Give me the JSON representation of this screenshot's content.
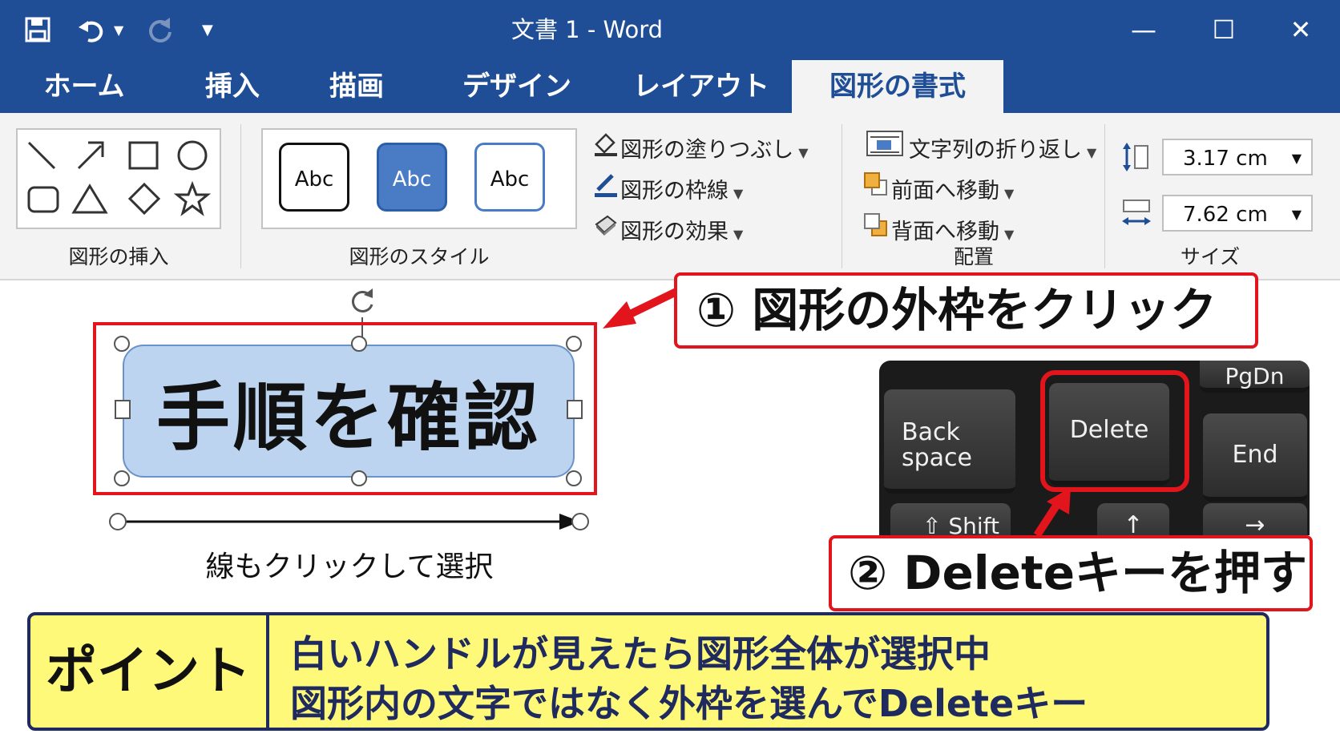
{
  "window": {
    "title": "文書 1 - Word",
    "minimize": "—",
    "maximize": "☐",
    "close": "✕"
  },
  "quick_access": {
    "save_icon": "save-icon",
    "undo_icon": "undo-icon",
    "redo_icon": "redo-icon",
    "customize_icon": "customize-icon"
  },
  "tabs": [
    {
      "label": "ホーム"
    },
    {
      "label": "挿入"
    },
    {
      "label": "描画"
    },
    {
      "label": "デザイン"
    },
    {
      "label": "レイアウト"
    },
    {
      "label": "図形の書式",
      "active": true
    }
  ],
  "ribbon": {
    "insert_shapes": {
      "label": "図形の挿入",
      "shapes": [
        "line-icon",
        "arrow-icon",
        "rectangle-icon",
        "oval-icon",
        "rounded-rectangle-icon",
        "triangle-icon",
        "diamond-icon",
        "star-icon"
      ]
    },
    "shape_styles": {
      "label": "図形のスタイル",
      "samples": [
        "Abc",
        "Abc",
        "Abc"
      ],
      "fill": "図形の塗りつぶし",
      "outline": "図形の枠線",
      "effects": "図形の効果"
    },
    "arrange": {
      "label": "配置",
      "wrap": "文字列の折り返し",
      "bring_forward": "前面へ移動",
      "send_backward": "背面へ移動"
    },
    "size": {
      "label": "サイズ",
      "height": "3.17 cm",
      "width": "7.62 cm"
    }
  },
  "document": {
    "shape_text": "手順を確認",
    "line_caption": "線もクリックして選択",
    "callout1": "① 図形の外枠をクリック",
    "callout2": "② Deleteキーを押す",
    "keyboard": {
      "backspace": [
        "Back",
        "space"
      ],
      "delete": "Delete",
      "pgdn": "PgDn",
      "end": "End",
      "shift": "⇧ Shift",
      "up": "↑",
      "right": "→"
    }
  },
  "point": {
    "label": "ポイント",
    "line1": "白いハンドルが見えたら図形全体が選択中",
    "line2": "図形内の文字ではなく外枠を選んでDeleteキー"
  },
  "colors": {
    "title_bar": "#1f4e96",
    "accent_red": "#e2141c",
    "shape_fill": "#bcd4ef",
    "point_bg": "#fff97a",
    "point_border": "#1f2a5e"
  }
}
